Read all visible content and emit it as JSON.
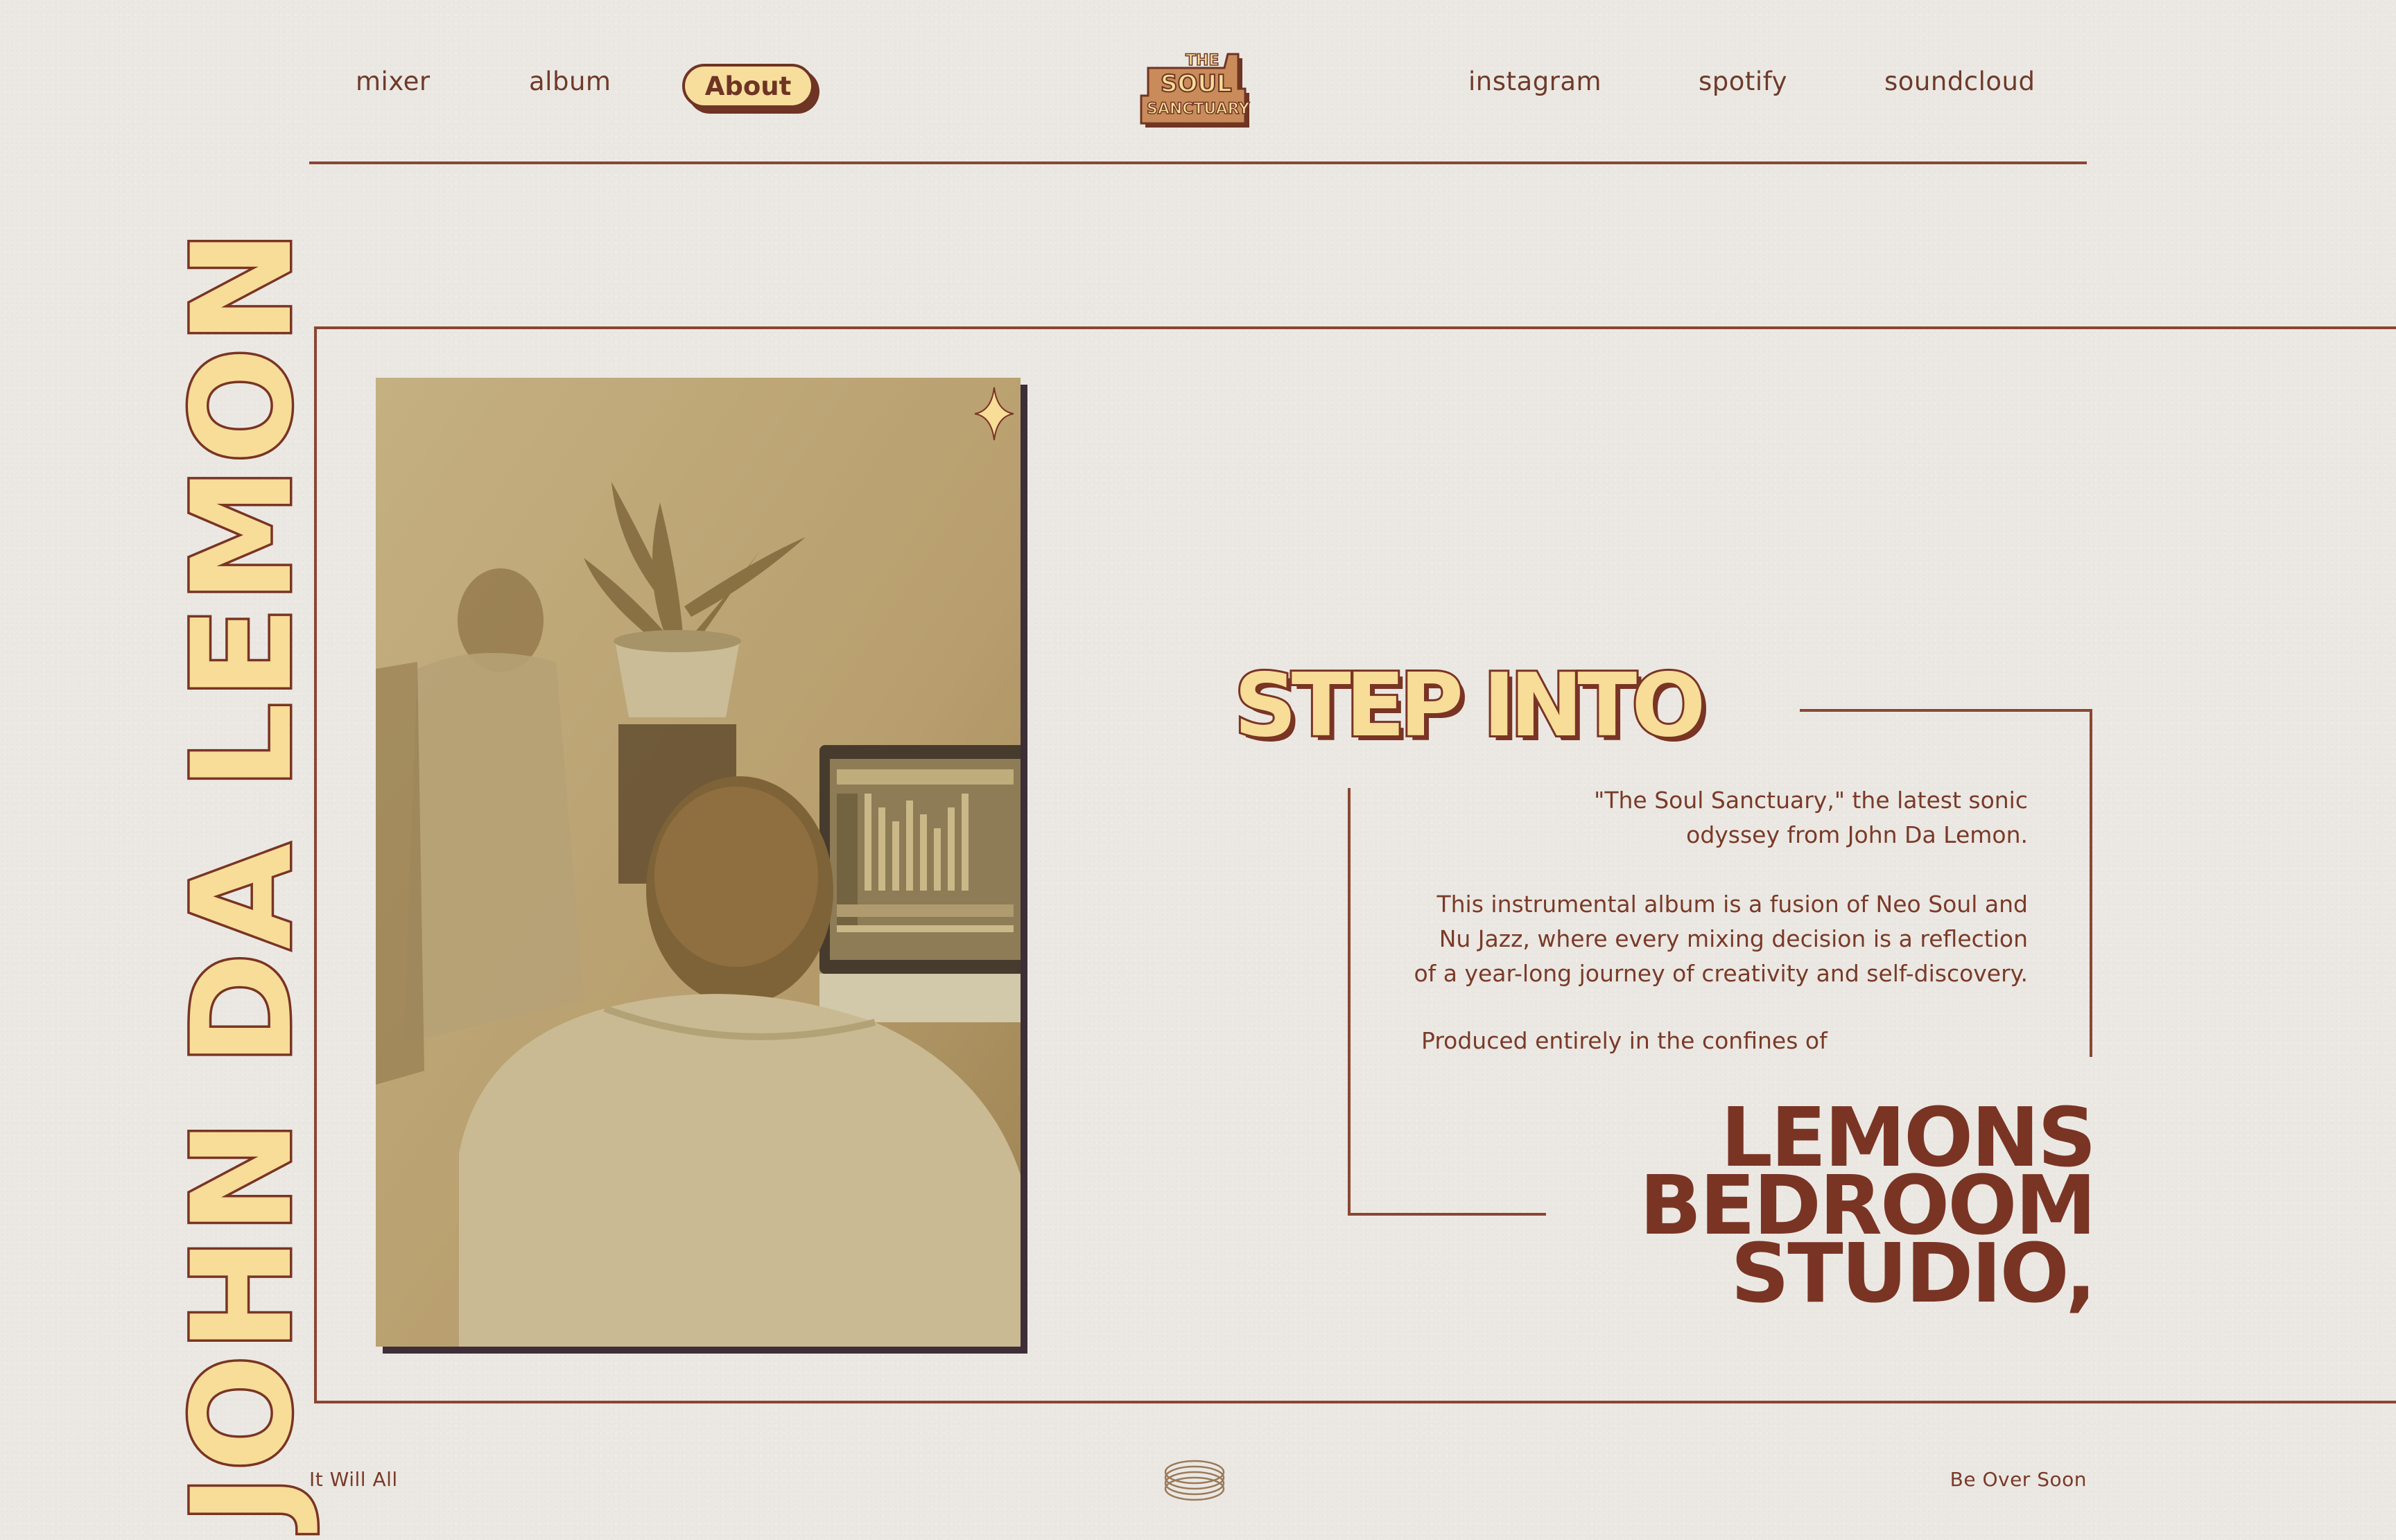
{
  "nav": {
    "left_links": [
      "mixer",
      "album"
    ],
    "active_link": "About",
    "right_links": [
      "instagram",
      "spotify",
      "soundcloud"
    ]
  },
  "logo": {
    "line1": "THE",
    "line2": "SOUL",
    "line3": "SANCTUARY"
  },
  "artist_name": "JOHN DA LEMON",
  "headline": "STEP INTO",
  "description": {
    "p1": "\"The Soul Sanctuary,\" the latest sonic\nodyssey from John Da Lemon.",
    "p2": "This instrumental album is a fusion of Neo Soul and\nNu Jazz, where every mixing decision is a reflection\nof a year-long journey of creativity and self-discovery.",
    "p3": "Produced entirely in the confines of"
  },
  "studio_title": "LEMONS\nBEDROOM\nSTUDIO,",
  "footer": {
    "left": "It Will All",
    "right": "Be Over Soon"
  },
  "colors": {
    "background": "#ebe8e3",
    "brown": "#7a3424",
    "yellow": "#f7dd98"
  },
  "icons": [
    "sparkle-icon",
    "coil-icon"
  ]
}
